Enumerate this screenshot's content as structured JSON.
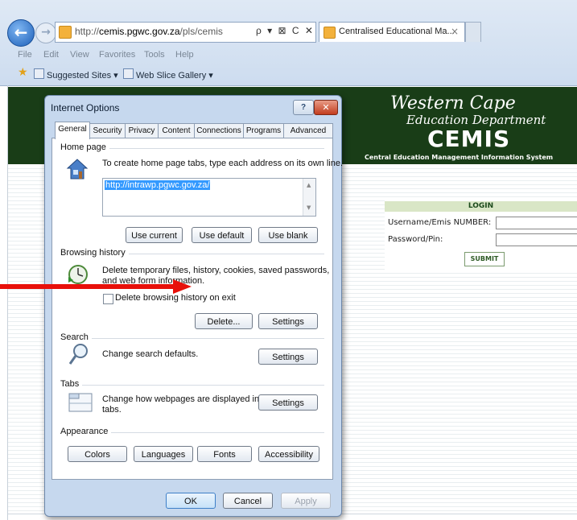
{
  "browser": {
    "address_prefix": "http://",
    "address_domain": "cemis.pgwc.gov.za",
    "address_path": "/pls/cemis",
    "address_tools": "ρ ▾ ⊠ C ✕",
    "tab_title": "Centralised Educational Ma...",
    "tab_close": "×",
    "back_icon": "←",
    "forward_icon": "→",
    "menu": [
      "File",
      "Edit",
      "View",
      "Favorites",
      "Tools",
      "Help"
    ],
    "favorites": {
      "suggested_sites": "Suggested Sites ▾",
      "web_slice_gallery": "Web Slice Gallery ▾"
    }
  },
  "page": {
    "banner": {
      "title": "Western Cape",
      "subtitle": "Education Department",
      "acronym": "CEMIS",
      "full_name": "Central Education Management Information System"
    },
    "login": {
      "header": "LOGIN",
      "username_label": "Username/Emis NUMBER:",
      "password_label": "Password/Pin:",
      "submit_label": "SUBMIT"
    }
  },
  "dialog": {
    "title": "Internet Options",
    "help_label": "?",
    "close_label": "✕",
    "tabs": [
      "General",
      "Security",
      "Privacy",
      "Content",
      "Connections",
      "Programs",
      "Advanced"
    ],
    "active_tab": "General",
    "home_page": {
      "section": "Home page",
      "description": "To create home page tabs, type each address on its own line.",
      "url": "http://intrawp.pgwc.gov.za/",
      "buttons": {
        "use_current": "Use current",
        "use_default": "Use default",
        "use_blank": "Use blank"
      }
    },
    "browsing_history": {
      "section": "Browsing history",
      "description_line1": "Delete temporary files, history, cookies, saved passwords,",
      "description_line2": "and web form information.",
      "checkbox_label": "Delete browsing history on exit",
      "checkbox_checked": false,
      "delete_button": "Delete...",
      "settings_button": "Settings"
    },
    "search": {
      "section": "Search",
      "description": "Change search defaults.",
      "settings_button": "Settings"
    },
    "tabs_section": {
      "section": "Tabs",
      "description_line1": "Change how webpages are displayed in",
      "description_line2": "tabs.",
      "settings_button": "Settings"
    },
    "appearance": {
      "section": "Appearance",
      "buttons": {
        "colors": "Colors",
        "languages": "Languages",
        "fonts": "Fonts",
        "accessibility": "Accessibility"
      }
    },
    "footer": {
      "ok": "OK",
      "cancel": "Cancel",
      "apply": "Apply"
    }
  },
  "annotation": {
    "arrow_color": "#e8100a"
  },
  "colors": {
    "banner_green": "#193d17",
    "dialog_frame": "#c6d8ee",
    "selection_blue": "#3399ff"
  }
}
